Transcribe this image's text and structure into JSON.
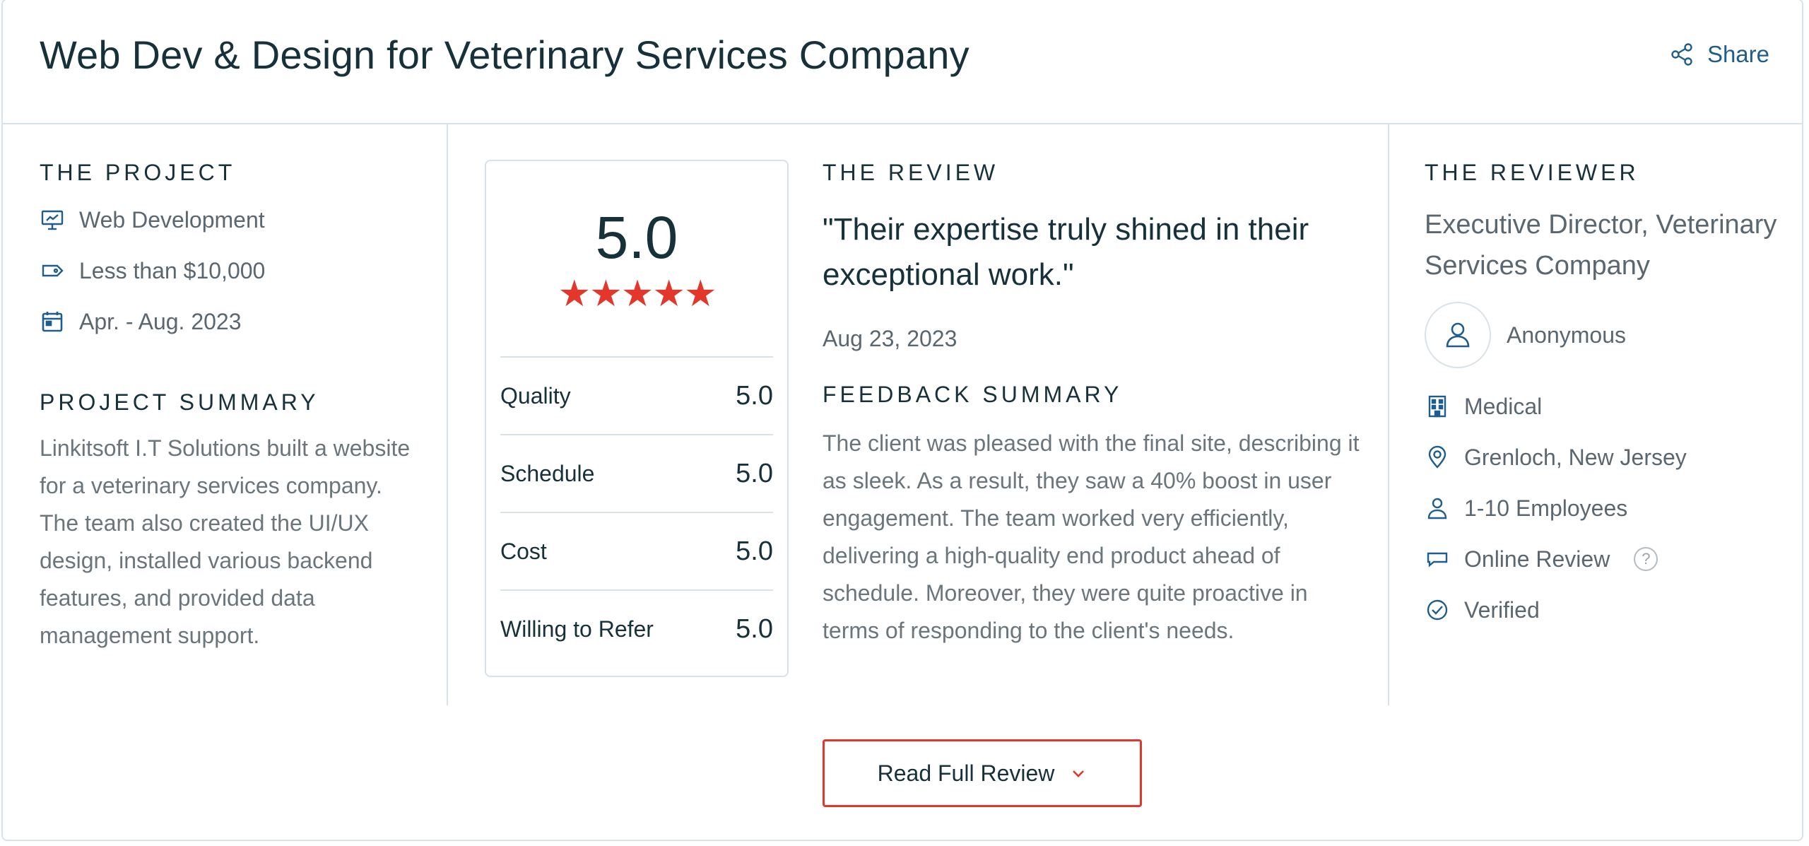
{
  "header": {
    "title": "Web Dev & Design for Veterinary Services Company",
    "share_label": "Share"
  },
  "project": {
    "label": "THE PROJECT",
    "items": [
      {
        "icon": "presentation-icon",
        "text": "Web Development"
      },
      {
        "icon": "price-tag-icon",
        "text": "Less than $10,000"
      },
      {
        "icon": "calendar-icon",
        "text": "Apr. - Aug. 2023"
      }
    ],
    "summary_label": "PROJECT SUMMARY",
    "summary": "Linkitsoft I.T Solutions built a website for a veterinary services company. The team also created the UI/UX design, installed various backend features, and provided data management support."
  },
  "rating": {
    "overall": "5.0",
    "stars": 5,
    "rows": [
      {
        "label": "Quality",
        "value": "5.0"
      },
      {
        "label": "Schedule",
        "value": "5.0"
      },
      {
        "label": "Cost",
        "value": "5.0"
      },
      {
        "label": "Willing to Refer",
        "value": "5.0"
      }
    ]
  },
  "review": {
    "label": "THE REVIEW",
    "quote": "\"Their expertise truly shined in their exceptional work.\"",
    "date": "Aug 23, 2023",
    "feedback_label": "FEEDBACK SUMMARY",
    "feedback": "The client was pleased with the final site, describing it as sleek. As a result, they saw a 40% boost in user engagement. The team worked very efficiently, delivering a high-quality end product ahead of schedule. Moreover, they were quite proactive in terms of responding to the client's needs."
  },
  "reviewer": {
    "label": "THE REVIEWER",
    "title": "Executive Director, Veterinary Services Company",
    "name": "Anonymous",
    "details": [
      {
        "icon": "building-icon",
        "text": "Medical"
      },
      {
        "icon": "location-pin-icon",
        "text": "Grenloch, New Jersey"
      },
      {
        "icon": "person-icon",
        "text": "1-10 Employees"
      },
      {
        "icon": "chat-bubble-icon",
        "text": "Online Review"
      },
      {
        "icon": "check-circle-icon",
        "text": "Verified"
      }
    ],
    "help_glyph": "?"
  },
  "actions": {
    "read_full_review": "Read Full Review"
  },
  "colors": {
    "accent_red": "#e2372a",
    "link_blue": "#1f5d8c",
    "border": "#d9e2e8",
    "heading": "#17313b"
  }
}
